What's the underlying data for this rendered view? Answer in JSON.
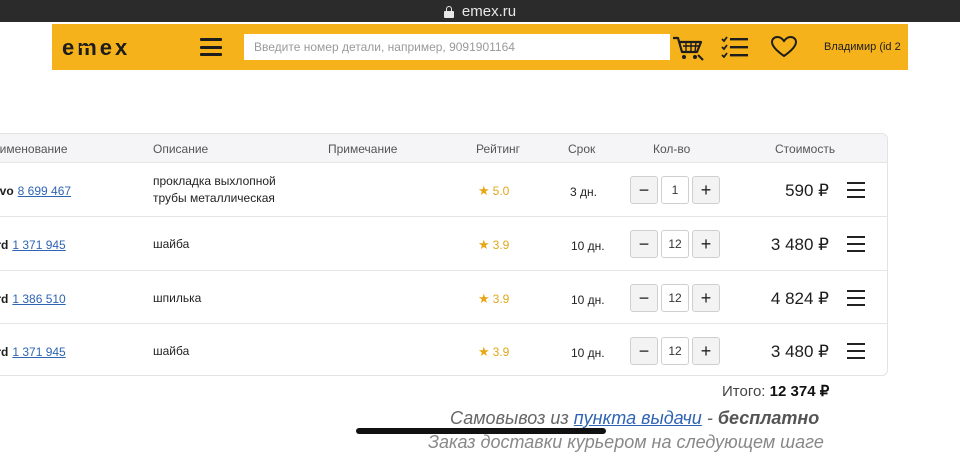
{
  "browser": {
    "url": "emex.ru"
  },
  "header": {
    "logo": "emex",
    "search_placeholder": "Введите номер детали, например, 9091901164",
    "user": "Владимир  (id 2"
  },
  "table": {
    "columns": [
      "аименование",
      "Описание",
      "Примечание",
      "Рейтинг",
      "Срок",
      "Кол-во",
      "Стоимость"
    ],
    "rows": [
      {
        "brand": "olvo",
        "part_no": "8 699 467",
        "desc1": "прокладка выхлопной",
        "desc2": "трубы металлическая",
        "rating": "5.0",
        "term": "3 дн.",
        "qty": "1",
        "price": "590 ₽"
      },
      {
        "brand": "ord",
        "part_no": "1 371 945",
        "desc1": "шайба",
        "desc2": "",
        "rating": "3.9",
        "term": "10 дн.",
        "qty": "12",
        "price": "3 480 ₽"
      },
      {
        "brand": "ord",
        "part_no": "1 386 510",
        "desc1": "шпилька",
        "desc2": "",
        "rating": "3.9",
        "term": "10 дн.",
        "qty": "12",
        "price": "4 824 ₽"
      },
      {
        "brand": "ord",
        "part_no": "1 371 945",
        "desc1": "шайба",
        "desc2": "",
        "rating": "3.9",
        "term": "10 дн.",
        "qty": "12",
        "price": "3 480 ₽"
      }
    ],
    "minus_label": "−",
    "plus_label": "+"
  },
  "summary": {
    "total_label": "Итого:",
    "total_value": "12 374 ₽",
    "pickup_prefix": "Самовывоз из ",
    "pickup_link": "пункта выдачи",
    "pickup_suffix": " - ",
    "pickup_free": "бесплатно",
    "courier": "Заказ доставки курьером на следующем шаге"
  },
  "colors": {
    "brand_yellow": "#f6b21b",
    "link_blue": "#2f64b3",
    "star": "#e9a614"
  }
}
